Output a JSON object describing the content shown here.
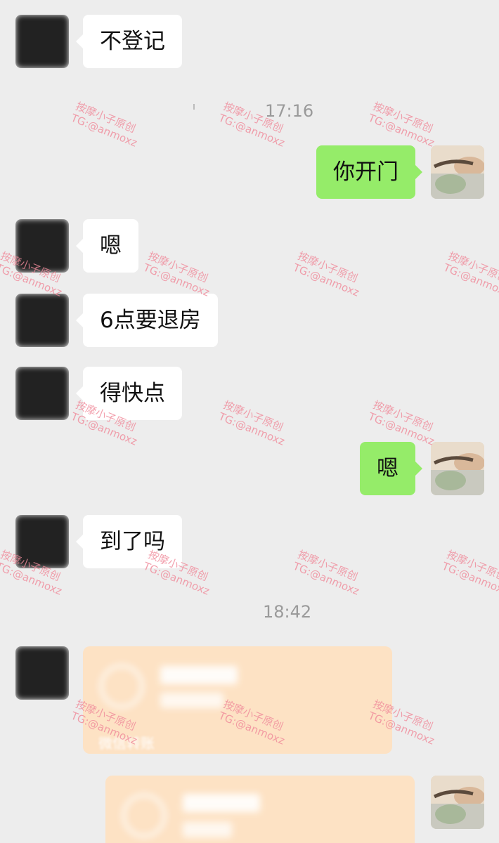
{
  "messages": [
    {
      "text": "不登记"
    },
    {
      "text": "你开门"
    },
    {
      "text": "嗯"
    },
    {
      "text": "6点要退房"
    },
    {
      "text": "得快点"
    },
    {
      "text": "嗯"
    },
    {
      "text": "到了吗"
    }
  ],
  "timestamps": [
    "17:16",
    "18:42"
  ],
  "transfer_in": {
    "footer": "微信转账"
  },
  "watermark": {
    "line1": "按摩小子原创",
    "line2": "TG:@anmoxz"
  },
  "colors": {
    "bg": "#ededed",
    "incoming": "#ffffff",
    "outgoing": "#95ec69",
    "transfer": "#fde2c4",
    "watermark": "#f08a9a"
  }
}
